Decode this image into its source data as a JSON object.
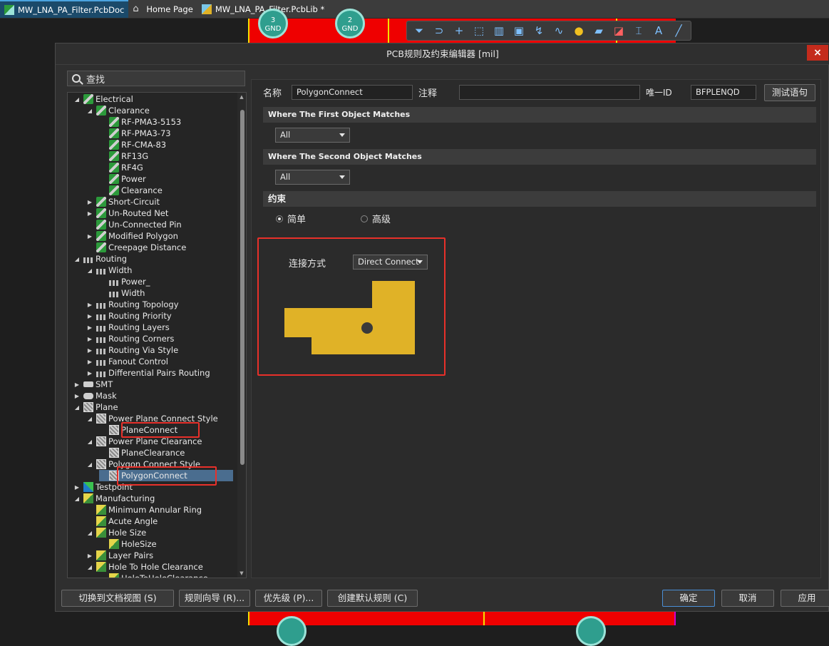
{
  "tabs": [
    {
      "label": "MW_LNA_PA_Filter.PcbDoc",
      "active": true
    },
    {
      "label": "Home Page",
      "active": false
    },
    {
      "label": "MW_LNA_PA_Filter.PcbLib *",
      "active": false
    }
  ],
  "pcb": {
    "pads_top": [
      "3\nGND",
      "2\nGND"
    ]
  },
  "dialog": {
    "title": "PCB规则及约束编辑器 [mil]",
    "close_label": "×",
    "search_placeholder": "查找"
  },
  "tree": [
    {
      "label": "Electrical",
      "expanded": true,
      "icon": "electrical-rule-icon",
      "level": 0
    },
    {
      "label": "Clearance",
      "expanded": true,
      "icon": "electrical-rule-icon",
      "level": 1
    },
    {
      "label": "RF-PMA3-5153",
      "icon": "electrical-rule-icon",
      "level": 2
    },
    {
      "label": "RF-PMA3-73",
      "icon": "electrical-rule-icon",
      "level": 2
    },
    {
      "label": "RF-CMA-83",
      "icon": "electrical-rule-icon",
      "level": 2
    },
    {
      "label": "RF13G",
      "icon": "electrical-rule-icon",
      "level": 2
    },
    {
      "label": "RF4G",
      "icon": "electrical-rule-icon",
      "level": 2
    },
    {
      "label": "Power",
      "icon": "electrical-rule-icon",
      "level": 2
    },
    {
      "label": "Clearance",
      "icon": "electrical-rule-icon",
      "level": 2
    },
    {
      "label": "Short-Circuit",
      "expanded": false,
      "icon": "electrical-rule-icon",
      "level": 1
    },
    {
      "label": "Un-Routed Net",
      "expanded": false,
      "icon": "electrical-rule-icon",
      "level": 1
    },
    {
      "label": "Un-Connected Pin",
      "icon": "electrical-rule-icon",
      "level": 1
    },
    {
      "label": "Modified Polygon",
      "expanded": false,
      "icon": "electrical-rule-icon",
      "level": 1
    },
    {
      "label": "Creepage Distance",
      "icon": "electrical-rule-icon",
      "level": 1
    },
    {
      "label": "Routing",
      "expanded": true,
      "icon": "routing-rule-icon",
      "level": 0
    },
    {
      "label": "Width",
      "expanded": true,
      "icon": "routing-rule-icon",
      "level": 1
    },
    {
      "label": "Power_",
      "icon": "routing-rule-icon",
      "level": 2
    },
    {
      "label": "Width",
      "icon": "routing-rule-icon",
      "level": 2
    },
    {
      "label": "Routing Topology",
      "expanded": false,
      "icon": "routing-rule-icon",
      "level": 1
    },
    {
      "label": "Routing Priority",
      "expanded": false,
      "icon": "routing-rule-icon",
      "level": 1
    },
    {
      "label": "Routing Layers",
      "expanded": false,
      "icon": "routing-rule-icon",
      "level": 1
    },
    {
      "label": "Routing Corners",
      "expanded": false,
      "icon": "routing-rule-icon",
      "level": 1
    },
    {
      "label": "Routing Via Style",
      "expanded": false,
      "icon": "routing-rule-icon",
      "level": 1
    },
    {
      "label": "Fanout Control",
      "expanded": false,
      "icon": "routing-rule-icon",
      "level": 1
    },
    {
      "label": "Differential Pairs Routing",
      "expanded": false,
      "icon": "routing-rule-icon",
      "level": 1
    },
    {
      "label": "SMT",
      "expanded": false,
      "icon": "smt-rule-icon",
      "level": 0
    },
    {
      "label": "Mask",
      "expanded": false,
      "icon": "mask-rule-icon",
      "level": 0
    },
    {
      "label": "Plane",
      "expanded": true,
      "icon": "plane-rule-icon",
      "level": 0
    },
    {
      "label": "Power Plane Connect Style",
      "expanded": true,
      "icon": "plane-rule-icon",
      "level": 1
    },
    {
      "label": "PlaneConnect",
      "icon": "plane-rule-icon",
      "level": 2
    },
    {
      "label": "Power Plane Clearance",
      "expanded": true,
      "icon": "plane-rule-icon",
      "level": 1
    },
    {
      "label": "PlaneClearance",
      "icon": "plane-rule-icon",
      "level": 2
    },
    {
      "label": "Polygon Connect Style",
      "expanded": true,
      "icon": "plane-rule-icon",
      "level": 1
    },
    {
      "label": "PolygonConnect",
      "icon": "plane-rule-icon",
      "level": 2,
      "selected": true
    },
    {
      "label": "Testpoint",
      "expanded": false,
      "icon": "testpoint-rule-icon",
      "level": 0
    },
    {
      "label": "Manufacturing",
      "expanded": true,
      "icon": "manufacturing-rule-icon",
      "level": 0
    },
    {
      "label": "Minimum Annular Ring",
      "icon": "manufacturing-rule-icon",
      "level": 1
    },
    {
      "label": "Acute Angle",
      "icon": "manufacturing-rule-icon",
      "level": 1
    },
    {
      "label": "Hole Size",
      "expanded": true,
      "icon": "manufacturing-rule-icon",
      "level": 1
    },
    {
      "label": "HoleSize",
      "icon": "manufacturing-rule-icon",
      "level": 2
    },
    {
      "label": "Layer Pairs",
      "expanded": false,
      "icon": "manufacturing-rule-icon",
      "level": 1
    },
    {
      "label": "Hole To Hole Clearance",
      "expanded": true,
      "icon": "manufacturing-rule-icon",
      "level": 1
    },
    {
      "label": "HoleToHoleClearance",
      "icon": "manufacturing-rule-icon",
      "level": 2
    }
  ],
  "rule": {
    "name_label": "名称",
    "name_value": "PolygonConnect",
    "comment_label": "注释",
    "comment_value": "",
    "uid_label": "唯一ID",
    "uid_value": "BFPLENQD",
    "test_button": "测试语句",
    "first_match_title": "Where The First Object Matches",
    "first_match_value": "All",
    "second_match_title": "Where The Second Object Matches",
    "second_match_value": "All",
    "constraints_title": "约束",
    "mode_simple": "简单",
    "mode_advanced": "高级",
    "mode_selected": "simple",
    "connect_label": "连接方式",
    "connect_value": "Direct Connect",
    "preview_color": "#e0b227"
  },
  "buttons": {
    "switch_doc_view": "切换到文档视图 (S)",
    "rule_wizard": "规则向导 (R)...",
    "priority": "优先级 (P)...",
    "create_default": "创建默认规则 (C)",
    "ok": "确定",
    "cancel": "取消",
    "apply": "应用"
  },
  "colors": {
    "highlight": "#e8302a",
    "selected_row": "#4a6d8f",
    "pcb_red": "#ef0000"
  }
}
